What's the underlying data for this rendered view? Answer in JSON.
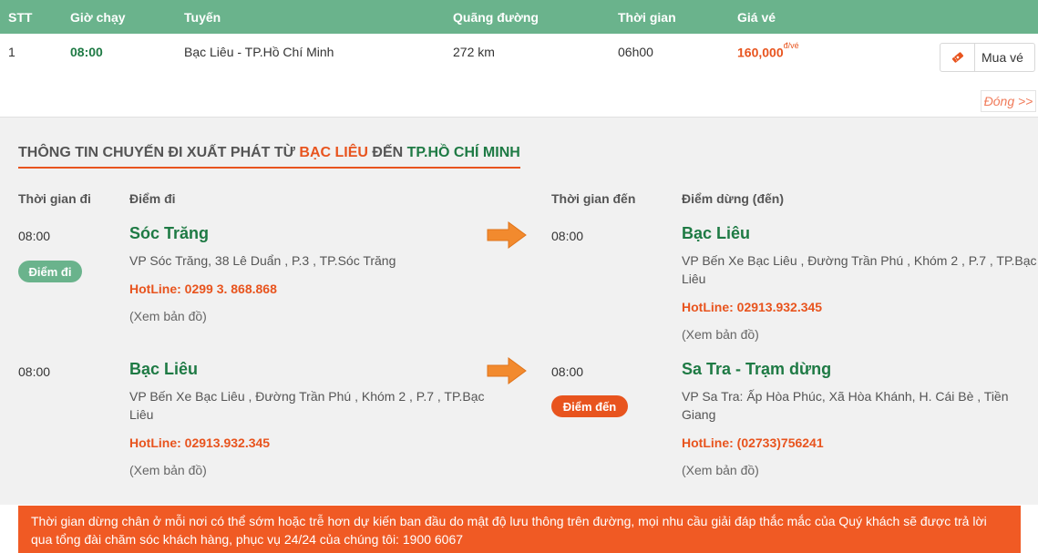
{
  "table": {
    "headers": {
      "stt": "STT",
      "depart_time": "Giờ chạy",
      "route": "Tuyến",
      "distance": "Quãng đường",
      "duration": "Thời gian",
      "price": "Giá vé"
    },
    "row": {
      "stt": "1",
      "depart_time": "08:00",
      "route": "Bạc Liêu - TP.Hồ Chí Minh",
      "distance": "272 km",
      "duration": "06h00",
      "price": "160,000",
      "price_unit": "đ/vé",
      "buy_label": "Mua vé"
    },
    "close_label": "Đóng >>"
  },
  "details": {
    "title_prefix": "THÔNG TIN CHUYẾN ĐI XUẤT PHÁT TỪ",
    "title_from": "BẠC LIÊU",
    "title_mid": "ĐẾN",
    "title_to": "TP.HỒ CHÍ MINH",
    "col_depart_time": "Thời gian đi",
    "col_depart_point": "Điểm đi",
    "col_arrive_time": "Thời gian đến",
    "col_arrive_point": "Điểm dừng (đến)",
    "badge_depart": "Điểm đi",
    "badge_arrive": "Điểm đến",
    "map_label": "(Xem bản đồ)",
    "segments": [
      {
        "depart": {
          "time": "08:00",
          "name": "Sóc Trăng",
          "address": "VP Sóc Trăng, 38 Lê Duẩn , P.3 , TP.Sóc Trăng",
          "hotline": "HotLine: 0299 3. 868.868"
        },
        "arrive": {
          "time": "08:00",
          "name": "Bạc Liêu",
          "address": "VP Bến Xe Bạc Liêu , Đường Trần Phú , Khóm 2 , P.7 , TP.Bạc Liêu",
          "hotline": "HotLine: 02913.932.345"
        }
      },
      {
        "depart": {
          "time": "08:00",
          "name": "Bạc Liêu",
          "address": "VP Bến Xe Bạc Liêu , Đường Trần Phú , Khóm 2 , P.7 , TP.Bạc Liêu",
          "hotline": "HotLine: 02913.932.345"
        },
        "arrive": {
          "time": "08:00",
          "name": "Sa Tra - Trạm dừng",
          "address": "VP Sa Tra: Ấp Hòa Phúc, Xã Hòa Khánh, H. Cái Bè , Tiền Giang",
          "hotline": "HotLine: (02733)756241"
        }
      }
    ]
  },
  "notice": "Thời gian dừng chân ở mỗi nơi có thể sớm hoặc trễ hơn dự kiến ban đầu do mật độ lưu thông trên đường, mọi nhu cầu giải đáp thắc mắc của Quý khách sẽ được trả lời qua tổng đài chăm sóc khách hàng, phục vụ 24/24 của chúng tôi: 1900 6067",
  "colors": {
    "header_green": "#6ab38c",
    "accent_orange": "#e8541e",
    "text_green": "#1e7a44",
    "notice_orange": "#f05a24"
  }
}
